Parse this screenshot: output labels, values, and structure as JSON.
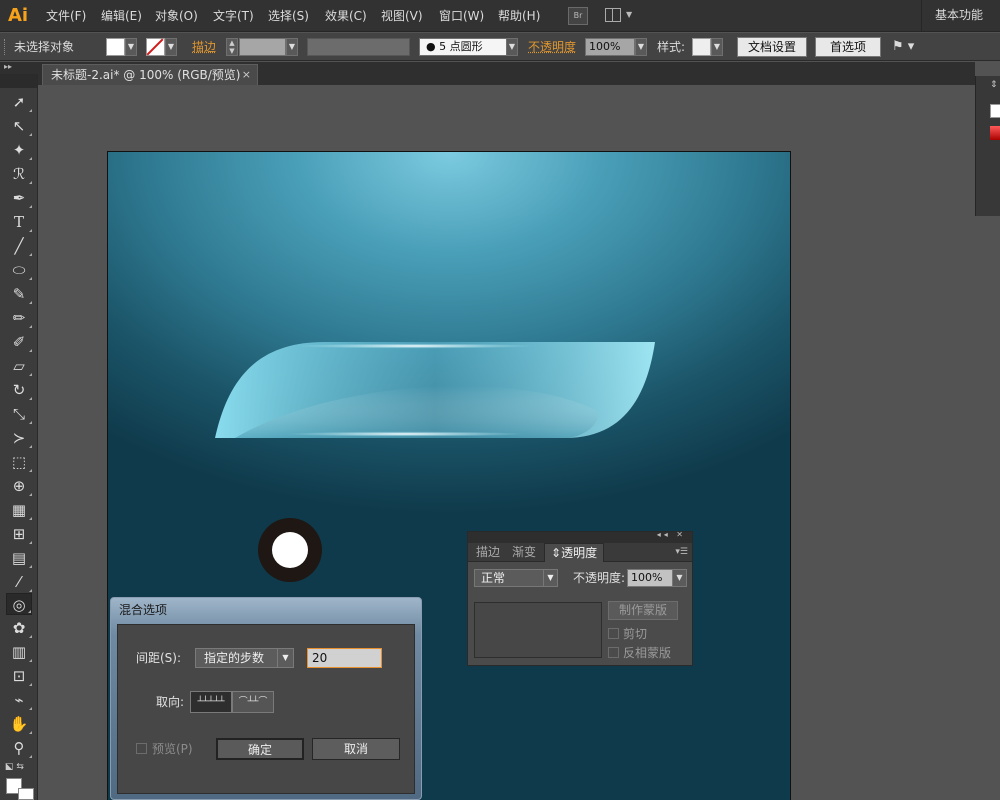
{
  "app": {
    "logo": "Ai"
  },
  "menu": [
    "文件(F)",
    "编辑(E)",
    "对象(O)",
    "文字(T)",
    "选择(S)",
    "效果(C)",
    "视图(V)",
    "窗口(W)",
    "帮助(H)"
  ],
  "bridge_button": "Br",
  "workspace": "基本功能",
  "control": {
    "selection_status": "未选择对象",
    "stroke_label": "描边",
    "brush_size": "5",
    "brush_shape": "点圆形",
    "opacity_label": "不透明度",
    "opacity_value": "100%",
    "style_label": "样式",
    "doc_setup": "文档设置",
    "preferences": "首选项"
  },
  "document_tab": {
    "title": "未标题-2.ai* @ 100% (RGB/预览)",
    "close": "×"
  },
  "tools": [
    "selection-tool",
    "direct-selection-tool",
    "magic-wand-tool",
    "lasso-tool",
    "pen-tool",
    "type-tool",
    "line-tool",
    "ellipse-tool",
    "paintbrush-tool",
    "pencil-tool",
    "blob-brush-tool",
    "eraser-tool",
    "rotate-tool",
    "scale-tool",
    "width-tool",
    "free-transform-tool",
    "shape-builder-tool",
    "mesh-tool",
    "gradient-tool",
    "eyedropper-tool",
    "blend-tool",
    "symbol-sprayer-tool",
    "graph-tool",
    "artboard-tool",
    "slice-tool",
    "hand-tool",
    "zoom-tool"
  ],
  "transparency_panel": {
    "tabs": [
      "描边",
      "渐变",
      "透明度"
    ],
    "active_tab": "透明度",
    "blend_mode": "正常",
    "opacity_label": "不透明度",
    "opacity_value": "100%",
    "make_mask": "制作蒙版",
    "clip": "剪切",
    "invert_mask": "反相蒙版"
  },
  "blend_dialog": {
    "title": "混合选项",
    "spacing_label": "间距(S):",
    "spacing_mode": "指定的步数",
    "steps": "20",
    "orientation_label": "取向:",
    "preview_label": "预览(P)",
    "ok": "确定",
    "cancel": "取消"
  },
  "colors": {
    "accent": "#e0962f",
    "artboard_top": "#7ccbe0",
    "artboard_bottom": "#0f3a4b",
    "ring": "#1e1713"
  }
}
